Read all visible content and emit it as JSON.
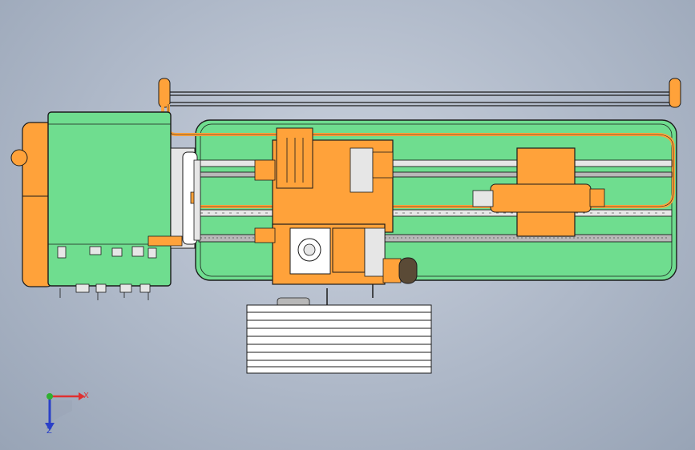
{
  "viewport": {
    "background": "#b2bccb"
  },
  "model": {
    "colors": {
      "bed": "#6fdd8f",
      "casting": "#ffa23a",
      "casting_dark": "#d97a14",
      "outline": "#1b1b1b",
      "steel": "#e6e6e6",
      "gray": "#b8b8b8",
      "motor": "#5a4a36"
    }
  },
  "triad": {
    "x_label": "X",
    "z_label": "Z",
    "x_color": "#e03030",
    "y_color": "#2fb02f",
    "z_color": "#2a40c8"
  }
}
